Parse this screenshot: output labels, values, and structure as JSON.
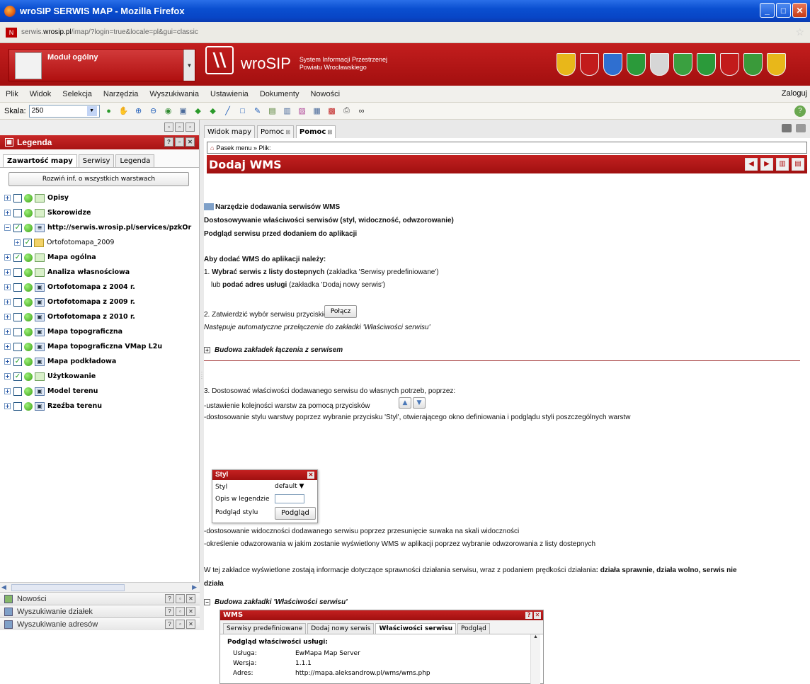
{
  "window": {
    "title": "wroSIP SERWIS MAP - Mozilla Firefox",
    "url_prefix": "serwis.",
    "url_domain": "wrosip.pl",
    "url_rest": "/imap/?login=true&locale=pl&gui=classic"
  },
  "header": {
    "module_title": "Moduł ogólny",
    "brand": "wroSIP",
    "brand_sub_1": "System Informacji Przestrzenej",
    "brand_sub_2": "Powiatu Wrocławskiego",
    "crest_colors": [
      "#e8b71a",
      "#c21b1b",
      "#2f6fd0",
      "#2b9a3a",
      "#d6d6d6",
      "#3aa040",
      "#2b9a3a",
      "#c21b1b",
      "#3a9a3a",
      "#e8b71a"
    ]
  },
  "menu": {
    "items": [
      "Plik",
      "Widok",
      "Selekcja",
      "Narzędzia",
      "Wyszukiwania",
      "Ustawienia",
      "Dokumenty",
      "Nowości"
    ],
    "login": "Zaloguj"
  },
  "toolbar": {
    "scale_label": "Skala:",
    "scale_value": "250",
    "icons": [
      "info-icon",
      "hand-icon",
      "zoom-in-icon",
      "zoom-out-icon",
      "globe-icon",
      "extent-icon",
      "back-icon",
      "forward-icon",
      "line-icon",
      "rect-icon",
      "edit-icon",
      "layers-icon",
      "measure-icon",
      "chart-icon",
      "table-icon",
      "grid-icon",
      "print-icon",
      "link-icon"
    ]
  },
  "left_panel": {
    "legend_title": "Legenda",
    "tabs": [
      "Zawartość mapy",
      "Serwisy",
      "Legenda"
    ],
    "expand_all": "Rozwiń inf. o wszystkich warstwach",
    "layers": [
      {
        "name": "Opisy",
        "checked": false,
        "icon": "label-icon",
        "child": false
      },
      {
        "name": "Skorowidze",
        "checked": false,
        "icon": "label-icon",
        "child": false
      },
      {
        "name": "http://serwis.wrosip.pl/services/pzkOr",
        "checked": true,
        "icon": "wms-icon",
        "child": false
      },
      {
        "name": "Ortofotomapa_2009",
        "checked": true,
        "icon": "folder-icon",
        "child": true
      },
      {
        "name": "Mapa ogólna",
        "checked": true,
        "icon": "label-icon",
        "child": false
      },
      {
        "name": "Analiza własnościowa",
        "checked": false,
        "icon": "label-icon",
        "child": false
      },
      {
        "name": "Ortofotomapa z 2004 r.",
        "checked": false,
        "icon": "raster-icon",
        "child": false
      },
      {
        "name": "Ortofotomapa z 2009 r.",
        "checked": false,
        "icon": "raster-icon",
        "child": false
      },
      {
        "name": "Ortofotomapa z 2010 r.",
        "checked": false,
        "icon": "raster-icon",
        "child": false
      },
      {
        "name": "Mapa topograficzna",
        "checked": false,
        "icon": "raster-icon",
        "child": false
      },
      {
        "name": "Mapa topograficzna VMap L2u",
        "checked": false,
        "icon": "raster-icon",
        "child": false
      },
      {
        "name": "Mapa podkładowa",
        "checked": true,
        "icon": "raster-icon",
        "child": false
      },
      {
        "name": "Użytkowanie",
        "checked": true,
        "icon": "label-icon",
        "child": false
      },
      {
        "name": "Model terenu",
        "checked": false,
        "icon": "raster-icon",
        "child": false
      },
      {
        "name": "Rzeźba terenu",
        "checked": false,
        "icon": "raster-icon",
        "child": false
      }
    ],
    "accordion": [
      "Nowości",
      "Wyszukiwanie działek",
      "Wyszukiwanie adresów"
    ]
  },
  "right_panel": {
    "tabs": [
      {
        "label": "Widok mapy",
        "closable": false
      },
      {
        "label": "Pomoc",
        "closable": true
      },
      {
        "label": "Pomoc",
        "closable": true
      }
    ],
    "breadcrumb": "Pasek menu » Plik:",
    "page_title": "Dodaj WMS",
    "content": {
      "h1": "Narzędzie dodawania serwisów WMS",
      "h2": "Dostosowywanie właściwości serwisów (styl, widoczność, odwzorowanie)",
      "h3": "Podgląd serwisu przed dodaniem do aplikacji",
      "how_to": "Aby dodać WMS do aplikacji należy:",
      "step1_a": "1. ",
      "step1_b": "Wybrać serwis z listy dostepnych",
      "step1_c": " (zakładka 'Serwisy predefiniowane')",
      "step1_d": "lub ",
      "step1_e": "podać adres usługi",
      "step1_f": " (zakładka 'Dodaj nowy serwis')",
      "step2": "2. Zatwierdzić wybór serwisu przyciskiem",
      "connect_btn": "Połącz",
      "step2_note": "Następuje automatyczne przełączenie do zakładki 'Właściwości serwisu'",
      "section1": "Budowa zakładek łączenia z serwisem",
      "step3": "3. Dostosować właściwości dodawanego serwisu do własnych potrzeb, poprzez:",
      "bullet1": "-ustawienie kolejności warstw za pomocą przycisków",
      "bullet2": "-dostosowanie stylu warstwy poprzez wybranie przycisku 'Styl', otwierającego okno definiowania i podglądu styli poszczególnych warstw",
      "bullet3": "-dostosowanie widoczności dodawanego serwisu poprzez przesunięcie suwaka na skali widoczności",
      "bullet4": "-określenie odwzorowania w jakim zostanie wyświetlony WMS w aplikacji poprzez wybranie odwzorowania z listy dostepnych",
      "para_a": "W tej zakładce wyświetlone zostają informacje dotyczące sprawności działania serwisu, wraz z podaniem prędkości działania",
      "para_b": ": działa sprawnie, działa wolno, serwis nie",
      "para_c": "działa",
      "section2": "Budowa zakładki 'Właściwości serwisu'"
    },
    "styl_dialog": {
      "title": "Styl",
      "row1_label": "Styl",
      "row1_value": "default",
      "row2_label": "Opis w legendzie",
      "row3_label": "Podgląd stylu",
      "row3_button": "Podgląd"
    },
    "wms_dialog": {
      "title": "WMS",
      "tabs": [
        "Serwisy predefiniowane",
        "Dodaj nowy serwis",
        "Właściwości serwisu",
        "Podgląd"
      ],
      "heading": "Podgląd właściwości usługi:",
      "rows": [
        {
          "label": "Usługa:",
          "value": "EwMapa Map Server"
        },
        {
          "label": "Wersja:",
          "value": "1.1.1"
        },
        {
          "label": "Adres:",
          "value": "http://mapa.aleksandrow.pl/wms/wms.php"
        }
      ]
    }
  }
}
